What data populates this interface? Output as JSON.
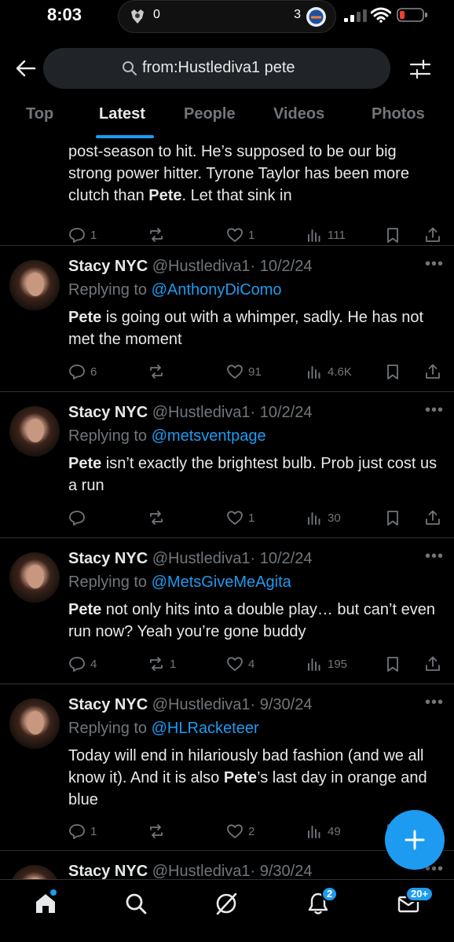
{
  "status_bar": {
    "time": "8:03",
    "left_count": "0",
    "right_count": "3"
  },
  "header": {
    "search_query": "from:Hustlediva1 pete"
  },
  "tabs": [
    {
      "label": "Top"
    },
    {
      "label": "Latest"
    },
    {
      "label": "People"
    },
    {
      "label": "Videos"
    },
    {
      "label": "Photos"
    }
  ],
  "tweets": [
    {
      "body_before": "post-season to hit. He’s supposed to be our big strong power hitter. Tyrone Taylor has been more clutch than ",
      "body_bold": "Pete",
      "body_after": ". Let that sink in",
      "replies": "1",
      "reposts": "",
      "likes": "1",
      "views": "111"
    },
    {
      "author": "Stacy NYC",
      "handle": "@Hustlediva1",
      "date": "· 10/2/24",
      "replying_prefix": "Replying to",
      "replying_to": "@AnthonyDiComo",
      "body_bold": "Pete",
      "body_after": " is going out with a whimper, sadly. He has not met the moment",
      "replies": "6",
      "reposts": "",
      "likes": "91",
      "views": "4.6K"
    },
    {
      "author": "Stacy NYC",
      "handle": "@Hustlediva1",
      "date": "· 10/2/24",
      "replying_prefix": "Replying to",
      "replying_to": "@metsventpage",
      "body_bold": "Pete",
      "body_after": " isn’t exactly the brightest bulb. Prob just cost us a run",
      "replies": "",
      "reposts": "",
      "likes": "1",
      "views": "30"
    },
    {
      "author": "Stacy NYC",
      "handle": "@Hustlediva1",
      "date": "· 10/2/24",
      "replying_prefix": "Replying to",
      "replying_to": "@MetsGiveMeAgita",
      "body_bold": "Pete",
      "body_after": " not only hits into a double play… but can’t even run now? Yeah you’re gone buddy",
      "replies": "4",
      "reposts": "1",
      "likes": "4",
      "views": "195"
    },
    {
      "author": "Stacy NYC",
      "handle": "@Hustlediva1",
      "date": "· 9/30/24",
      "replying_prefix": "Replying to",
      "replying_to": "@HLRacketeer",
      "body_before": "Today will end in hilariously bad fashion (and we all know it). And it is also ",
      "body_bold": "Pete",
      "body_after": "’s last day in orange and blue",
      "replies": "1",
      "reposts": "",
      "likes": "2",
      "views": "49"
    },
    {
      "author": "Stacy NYC",
      "handle": "@Hustlediva1",
      "date": "· 9/30/24"
    }
  ],
  "bottom_nav": {
    "notifications_badge": "2",
    "messages_badge": "20+"
  },
  "colors": {
    "accent": "#1d9bf0",
    "background": "#000000",
    "muted": "#71767b",
    "text": "#e7e9ea"
  }
}
